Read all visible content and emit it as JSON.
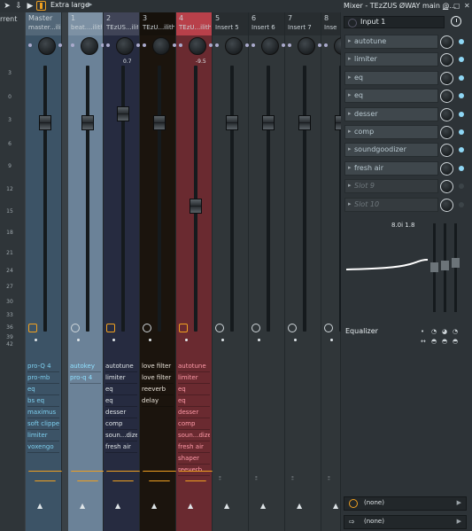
{
  "toolbar": {
    "size_label": "Extra large",
    "accent": "#f0a020"
  },
  "scale": {
    "current_label": "rrent",
    "ticks": [
      "3",
      "0",
      "3",
      "6",
      "9",
      "12",
      "15",
      "18",
      "21",
      "24",
      "27",
      "30",
      "33",
      "36",
      "39",
      "42"
    ]
  },
  "strips": [
    {
      "num": "Master",
      "sub": "master...ilith",
      "volume": "",
      "fx": [
        "pro-Q 4",
        "pro-mb",
        "eq",
        "bs eq",
        "maximus",
        "soft clipper",
        "limiter",
        "voxengo"
      ],
      "color": "#3c5366",
      "text": "#7ed0f0"
    },
    {
      "num": "1",
      "sub": "beat....ilith",
      "volume": "",
      "fx": [
        "autokey",
        "pro-q 4"
      ],
      "color": "#6b8298",
      "text": "#8fe0ff"
    },
    {
      "num": "2",
      "sub": "TEzUS...ilith",
      "volume": "0.7",
      "fx": [
        "autotune",
        "limiter",
        "eq",
        "eq",
        "desser",
        "comp",
        "soun...dizer",
        "fresh air"
      ],
      "color": "#262b40",
      "text": "#dfe5e8"
    },
    {
      "num": "3",
      "sub": "TEzU...ilith",
      "volume": "",
      "fx": [
        "love filter",
        "love filter",
        "reeverb",
        "delay"
      ],
      "color": "#1b140d",
      "text": "#e8e2d8"
    },
    {
      "num": "4",
      "sub": "TEzU...ilith",
      "volume": "-9.5",
      "fx": [
        "autotune",
        "limiter",
        "eq",
        "eq",
        "desser",
        "comp",
        "soun...dizer",
        "fresh air",
        "shaper",
        "reeverb"
      ],
      "color": "#6a2a30",
      "text": "#ff9aa8"
    },
    {
      "num": "5",
      "sub": "Insert 5",
      "volume": "",
      "fx": [],
      "color": "#303639",
      "text": "#dfe5e8"
    },
    {
      "num": "6",
      "sub": "Insert 6",
      "volume": "",
      "fx": [],
      "color": "#303639",
      "text": "#dfe5e8"
    },
    {
      "num": "7",
      "sub": "Insert 7",
      "volume": "",
      "fx": [],
      "color": "#303639",
      "text": "#dfe5e8"
    },
    {
      "num": "8",
      "sub": "Inse",
      "volume": "",
      "fx": [],
      "color": "#303639",
      "text": "#dfe5e8"
    }
  ],
  "panel": {
    "title": "Mixer - TEzZUS ØWAY main @...",
    "input_label": "Input 1",
    "slots": [
      "autotune",
      "limiter",
      "eq",
      "eq",
      "desser",
      "comp",
      "soundgoodizer",
      "fresh air",
      "Slot 9",
      "Slot 10"
    ],
    "eq_value": "8.0i 1.8",
    "eq_label": "Equalizer",
    "out1": "(none)",
    "out2": "(none)"
  }
}
